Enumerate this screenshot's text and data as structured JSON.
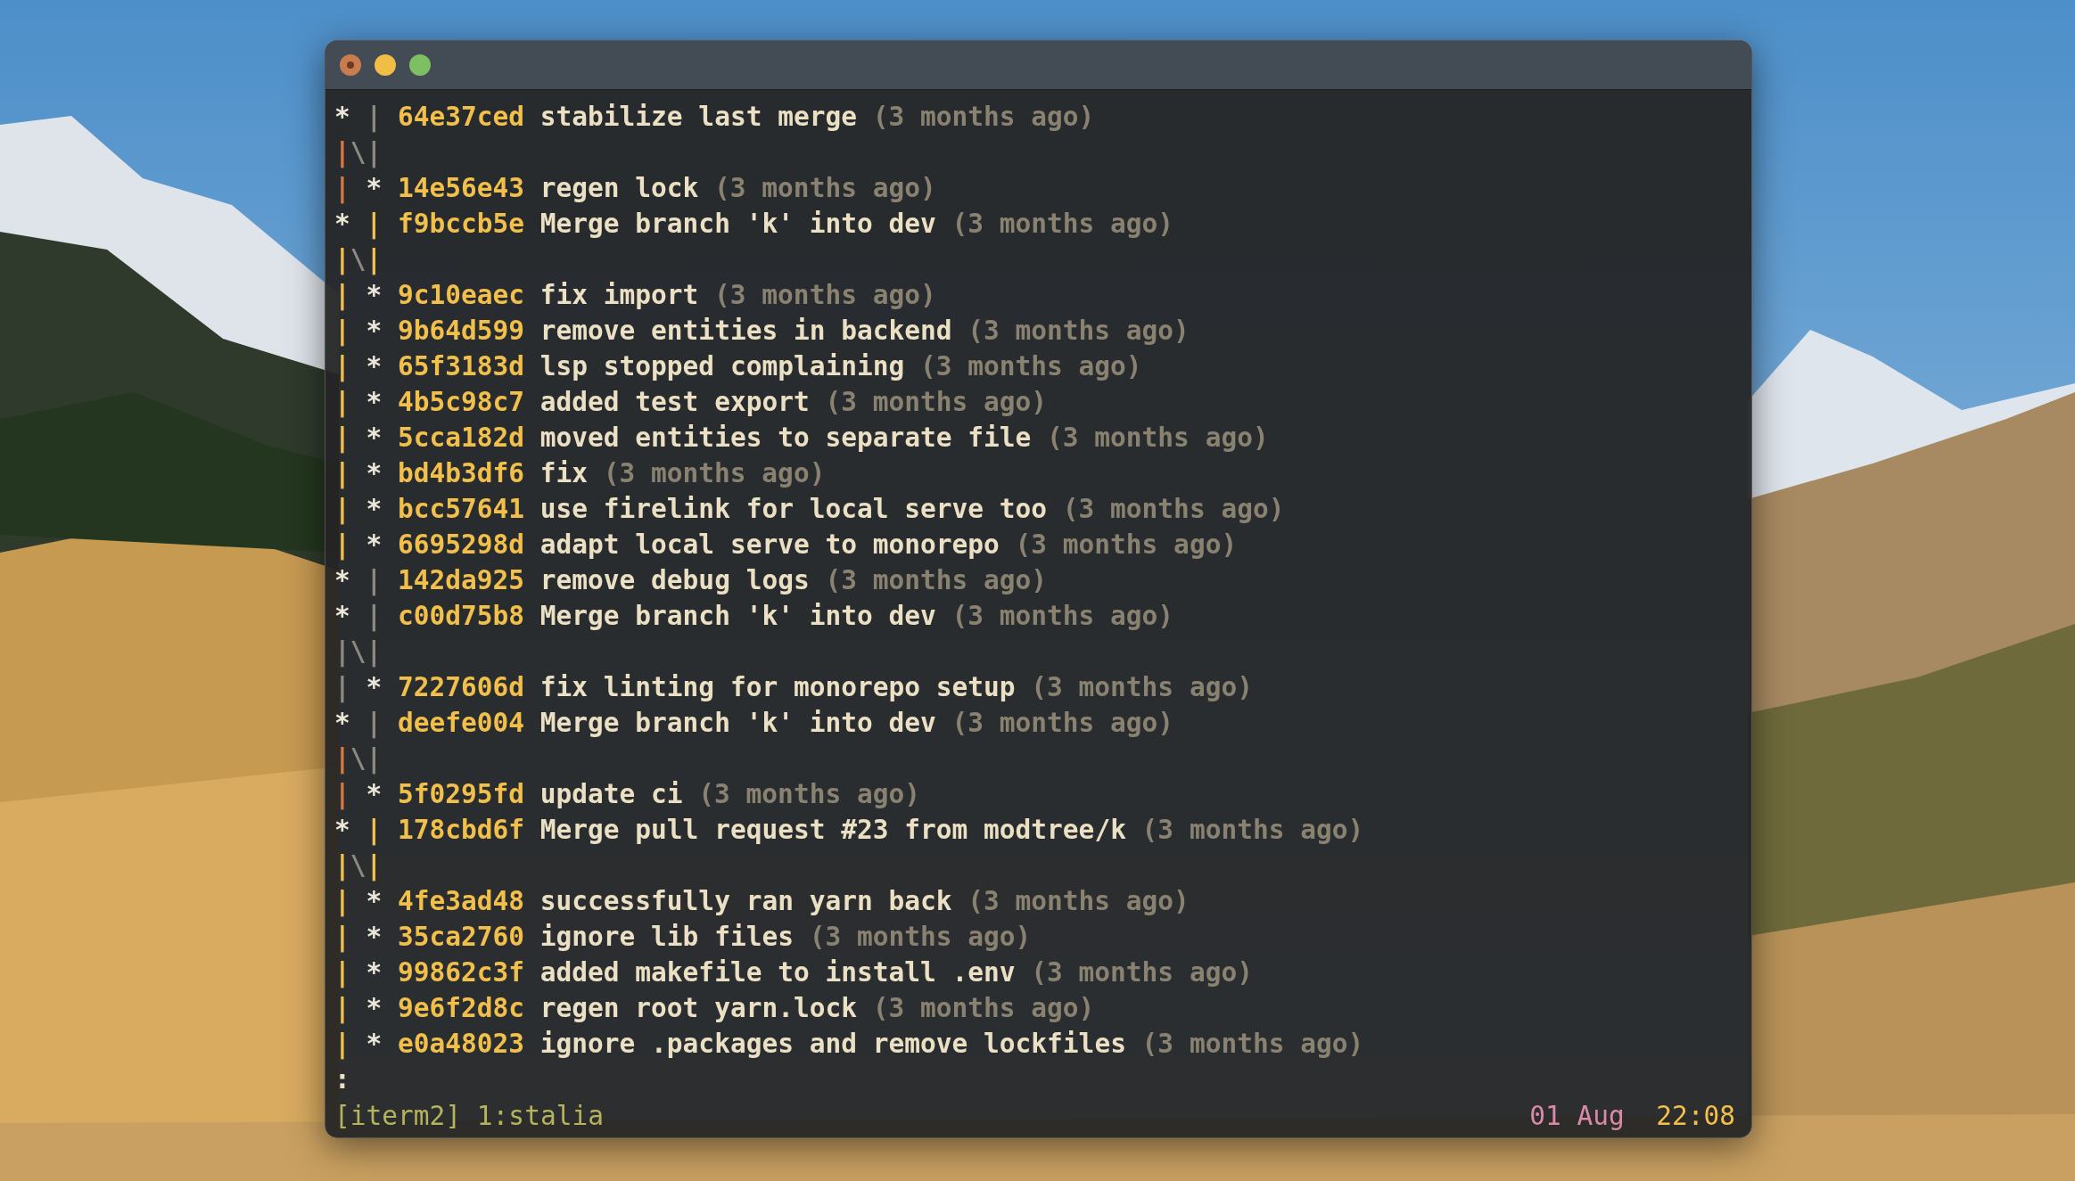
{
  "window": {
    "controls": [
      {
        "kind": "close",
        "color": "#c97c4e"
      },
      {
        "kind": "minimize",
        "color": "#f0bd45"
      },
      {
        "kind": "zoom",
        "color": "#7fbf63"
      }
    ]
  },
  "lines": [
    {
      "graph": [
        {
          "text": "* ",
          "color": "#ece6d8"
        },
        {
          "text": "|",
          "color": "#8c8a80"
        }
      ],
      "hash": "64e37ced",
      "message": "stabilize last merge",
      "date": "(3 months ago)"
    },
    {
      "graph": [
        {
          "text": "|",
          "color": "#d9783f"
        },
        {
          "text": "\\",
          "color": "#8c8a80"
        },
        {
          "text": "|",
          "color": "#8c8a80"
        }
      ]
    },
    {
      "graph": [
        {
          "text": "| ",
          "color": "#d9783f"
        },
        {
          "text": "*",
          "color": "#ece6d8"
        }
      ],
      "hash": "14e56e43",
      "message": "regen lock",
      "date": "(3 months ago)"
    },
    {
      "graph": [
        {
          "text": "* ",
          "color": "#ece6d8"
        },
        {
          "text": "|",
          "color": "#f2c04a"
        }
      ],
      "hash": "f9bccb5e",
      "message": "Merge branch 'k' into dev",
      "date": "(3 months ago)"
    },
    {
      "graph": [
        {
          "text": "|",
          "color": "#f2c04a"
        },
        {
          "text": "\\",
          "color": "#8c8a80"
        },
        {
          "text": "|",
          "color": "#f2c04a"
        }
      ]
    },
    {
      "graph": [
        {
          "text": "| ",
          "color": "#f2c04a"
        },
        {
          "text": "*",
          "color": "#ece6d8"
        }
      ],
      "hash": "9c10eaec",
      "message": "fix import",
      "date": "(3 months ago)"
    },
    {
      "graph": [
        {
          "text": "| ",
          "color": "#f2c04a"
        },
        {
          "text": "*",
          "color": "#ece6d8"
        }
      ],
      "hash": "9b64d599",
      "message": "remove entities in backend",
      "date": "(3 months ago)"
    },
    {
      "graph": [
        {
          "text": "| ",
          "color": "#f2c04a"
        },
        {
          "text": "*",
          "color": "#ece6d8"
        }
      ],
      "hash": "65f3183d",
      "message": "lsp stopped complaining",
      "date": "(3 months ago)"
    },
    {
      "graph": [
        {
          "text": "| ",
          "color": "#f2c04a"
        },
        {
          "text": "*",
          "color": "#ece6d8"
        }
      ],
      "hash": "4b5c98c7",
      "message": "added test export",
      "date": "(3 months ago)"
    },
    {
      "graph": [
        {
          "text": "| ",
          "color": "#f2c04a"
        },
        {
          "text": "*",
          "color": "#ece6d8"
        }
      ],
      "hash": "5cca182d",
      "message": "moved entities to separate file",
      "date": "(3 months ago)"
    },
    {
      "graph": [
        {
          "text": "| ",
          "color": "#f2c04a"
        },
        {
          "text": "*",
          "color": "#ece6d8"
        }
      ],
      "hash": "bd4b3df6",
      "message": "fix",
      "date": "(3 months ago)"
    },
    {
      "graph": [
        {
          "text": "| ",
          "color": "#f2c04a"
        },
        {
          "text": "*",
          "color": "#ece6d8"
        }
      ],
      "hash": "bcc57641",
      "message": "use firelink for local serve too",
      "date": "(3 months ago)"
    },
    {
      "graph": [
        {
          "text": "| ",
          "color": "#f2c04a"
        },
        {
          "text": "*",
          "color": "#ece6d8"
        }
      ],
      "hash": "6695298d",
      "message": "adapt local serve to monorepo",
      "date": "(3 months ago)"
    },
    {
      "graph": [
        {
          "text": "* ",
          "color": "#ece6d8"
        },
        {
          "text": "|",
          "color": "#8c8a80"
        }
      ],
      "hash": "142da925",
      "message": "remove debug logs",
      "date": "(3 months ago)"
    },
    {
      "graph": [
        {
          "text": "* ",
          "color": "#ece6d8"
        },
        {
          "text": "|",
          "color": "#8c8a80"
        }
      ],
      "hash": "c00d75b8",
      "message": "Merge branch 'k' into dev",
      "date": "(3 months ago)"
    },
    {
      "graph": [
        {
          "text": "|",
          "color": "#8c8a80"
        },
        {
          "text": "\\",
          "color": "#8c8a80"
        },
        {
          "text": "|",
          "color": "#8c8a80"
        }
      ]
    },
    {
      "graph": [
        {
          "text": "| ",
          "color": "#8c8a80"
        },
        {
          "text": "*",
          "color": "#ece6d8"
        }
      ],
      "hash": "7227606d",
      "message": "fix linting for monorepo setup",
      "date": "(3 months ago)"
    },
    {
      "graph": [
        {
          "text": "* ",
          "color": "#ece6d8"
        },
        {
          "text": "|",
          "color": "#8c8a80"
        }
      ],
      "hash": "deefe004",
      "message": "Merge branch 'k' into dev",
      "date": "(3 months ago)"
    },
    {
      "graph": [
        {
          "text": "|",
          "color": "#d9783f"
        },
        {
          "text": "\\",
          "color": "#8c8a80"
        },
        {
          "text": "|",
          "color": "#8c8a80"
        }
      ]
    },
    {
      "graph": [
        {
          "text": "| ",
          "color": "#d9783f"
        },
        {
          "text": "*",
          "color": "#ece6d8"
        }
      ],
      "hash": "5f0295fd",
      "message": "update ci",
      "date": "(3 months ago)"
    },
    {
      "graph": [
        {
          "text": "* ",
          "color": "#ece6d8"
        },
        {
          "text": "|",
          "color": "#f2c04a"
        }
      ],
      "hash": "178cbd6f",
      "message": "Merge pull request #23 from modtree/k",
      "date": "(3 months ago)"
    },
    {
      "graph": [
        {
          "text": "|",
          "color": "#f2c04a"
        },
        {
          "text": "\\",
          "color": "#8c8a80"
        },
        {
          "text": "|",
          "color": "#f2c04a"
        }
      ]
    },
    {
      "graph": [
        {
          "text": "| ",
          "color": "#f2c04a"
        },
        {
          "text": "*",
          "color": "#ece6d8"
        }
      ],
      "hash": "4fe3ad48",
      "message": "successfully ran yarn back",
      "date": "(3 months ago)"
    },
    {
      "graph": [
        {
          "text": "| ",
          "color": "#f2c04a"
        },
        {
          "text": "*",
          "color": "#ece6d8"
        }
      ],
      "hash": "35ca2760",
      "message": "ignore lib files",
      "date": "(3 months ago)"
    },
    {
      "graph": [
        {
          "text": "| ",
          "color": "#f2c04a"
        },
        {
          "text": "*",
          "color": "#ece6d8"
        }
      ],
      "hash": "99862c3f",
      "message": "added makefile to install .env",
      "date": "(3 months ago)"
    },
    {
      "graph": [
        {
          "text": "| ",
          "color": "#f2c04a"
        },
        {
          "text": "*",
          "color": "#ece6d8"
        }
      ],
      "hash": "9e6f2d8c",
      "message": "regen root yarn.lock",
      "date": "(3 months ago)"
    },
    {
      "graph": [
        {
          "text": "| ",
          "color": "#f2c04a"
        },
        {
          "text": "*",
          "color": "#ece6d8"
        }
      ],
      "hash": "e0a48023",
      "message": "ignore .packages and remove lockfiles",
      "date": "(3 months ago)"
    }
  ],
  "prompt": ":",
  "status_bar": {
    "session": "[iterm2] 1:stalia",
    "date": "01 Aug",
    "time": "22:08"
  }
}
